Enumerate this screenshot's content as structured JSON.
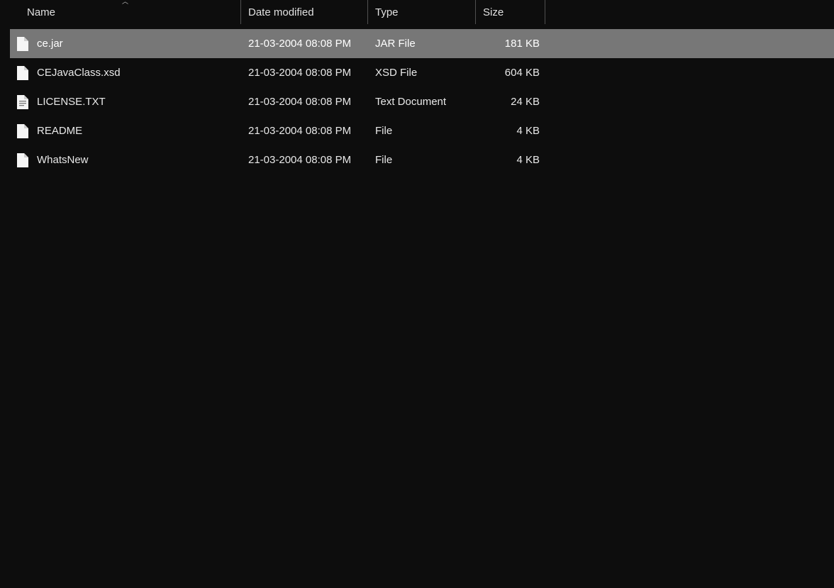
{
  "columns": {
    "name": "Name",
    "date": "Date modified",
    "type": "Type",
    "size": "Size"
  },
  "sort_indicator": "︿",
  "files": [
    {
      "name": "ce.jar",
      "date": "21-03-2004 08:08 PM",
      "type": "JAR File",
      "size": "181 KB",
      "icon": "blank",
      "selected": true
    },
    {
      "name": "CEJavaClass.xsd",
      "date": "21-03-2004 08:08 PM",
      "type": "XSD File",
      "size": "604 KB",
      "icon": "blank",
      "selected": false
    },
    {
      "name": "LICENSE.TXT",
      "date": "21-03-2004 08:08 PM",
      "type": "Text Document",
      "size": "24 KB",
      "icon": "text",
      "selected": false
    },
    {
      "name": "README",
      "date": "21-03-2004 08:08 PM",
      "type": "File",
      "size": "4 KB",
      "icon": "blank",
      "selected": false
    },
    {
      "name": "WhatsNew",
      "date": "21-03-2004 08:08 PM",
      "type": "File",
      "size": "4 KB",
      "icon": "blank",
      "selected": false
    }
  ]
}
